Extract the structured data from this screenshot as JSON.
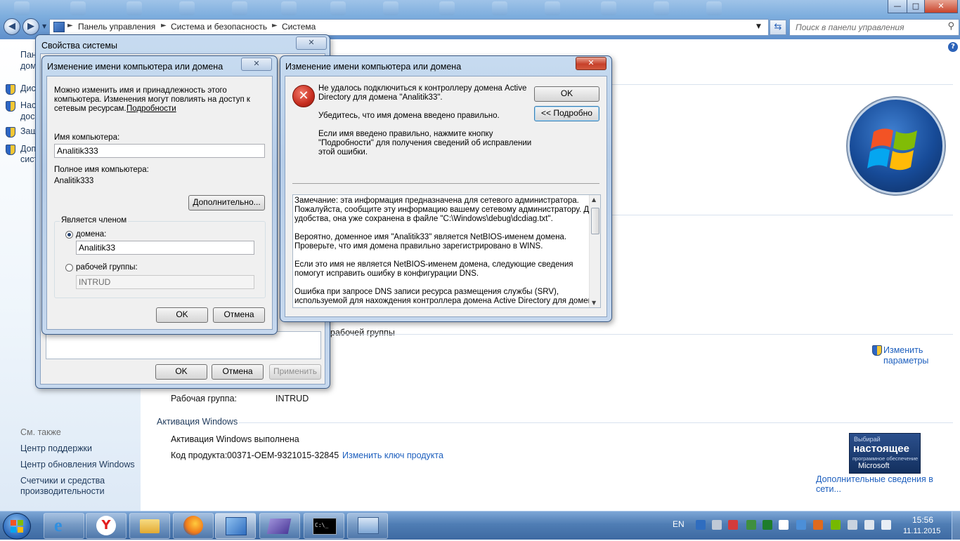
{
  "window": {
    "minimize": "—",
    "maximize": "□",
    "close": "✕"
  },
  "address": {
    "crumbs": [
      "Панель управления",
      "Система и безопасность",
      "Система"
    ],
    "separator": "►"
  },
  "search": {
    "placeholder": "Поиск в панели управления"
  },
  "left_pane": {
    "partial_items": [
      "Пан",
      "дом",
      "Дис",
      "Нас",
      "дос",
      "Защ",
      "Доп",
      "сист"
    ],
    "see_also_title": "См. также",
    "see_also": [
      "Центр поддержки",
      "Центр обновления Windows",
      "Счетчики и средства",
      "производительности"
    ]
  },
  "main": {
    "workgroup_fragment": "рабочей группы",
    "change_params": [
      "Изменить",
      "параметры"
    ],
    "workgroup_label": "Рабочая группа:",
    "workgroup_value": "INTRUD",
    "activation_header": "Активация Windows",
    "activation_status": "Активация Windows выполнена",
    "product_key_label": "Код продукта:",
    "product_key_value": "00371-OEM-9321015-32845",
    "change_key_link": "Изменить ключ продукта",
    "genuine_badge": {
      "line1": "Выбирай",
      "line2": "настоящее",
      "line3": "программное обеспечение",
      "line4": "Microsoft"
    },
    "more_info_link": "Дополнительные сведения в сети..."
  },
  "sysprops": {
    "title": "Свойства системы",
    "ok": "OK",
    "cancel": "Отмена",
    "apply": "Применить"
  },
  "rename": {
    "title": "Изменение имени компьютера или домена",
    "intro": [
      "Можно изменить имя и принадлежность этого",
      "компьютера. Изменения могут повлиять на доступ к",
      "сетевым ресурсам."
    ],
    "details_link": "Подробности",
    "computer_name_label": "Имя компьютера:",
    "computer_name_value": "Analitik333",
    "full_name_label": "Полное имя компьютера:",
    "full_name_value": "Analitik333",
    "more_button": "Дополнительно...",
    "member_of": "Является членом",
    "domain_label": "домена:",
    "domain_value": "Analitik33",
    "workgroup_label": "рабочей группы:",
    "workgroup_value": "INTRUD",
    "ok": "OK",
    "cancel": "Отмена"
  },
  "error": {
    "title": "Изменение имени компьютера или домена",
    "message": [
      "Не удалось подключиться к контроллеру домена Active",
      "Directory для домена \"Analitik33\"."
    ],
    "check": "Убедитесь, что имя домена введено правильно.",
    "hint": [
      "Если имя введено правильно, нажмите кнопку",
      "\"Подробности\" для получения сведений об исправлении",
      "этой ошибки."
    ],
    "ok": "OK",
    "details": "<< Подробно",
    "detail_text": [
      "Замечание: эта информация предназначена для сетевого администратора.",
      "Пожалуйста, сообщите эту информацию вашему сетевому администратору. Для",
      "удобства, она уже сохранена в файле \"C:\\Windows\\debug\\dcdiag.txt\".",
      "",
      "Вероятно, доменное имя \"Analitik33\" является NetBIOS-именем домена.",
      "Проверьте, что имя домена правильно зарегистрировано в WINS.",
      "",
      "Если это имя не является NetBIOS-именем домена, следующие сведения",
      "помогут исправить ошибку в конфигурации DNS.",
      "",
      "Ошибка при запросе DNS записи ресурса размещения службы (SRV),",
      "используемой для нахождения контроллера домена Active Directory для домена"
    ]
  },
  "taskbar": {
    "lang": "EN",
    "time": "15:56",
    "date": "11.11.2015",
    "apps": [
      "ie-icon",
      "yandex-icon",
      "explorer-icon",
      "firefox-icon",
      "control-panel-icon",
      "virtualbox-icon",
      "cmd-icon",
      "network-icon"
    ]
  },
  "colors": {
    "link": "#1d5fbe",
    "error_red": "#c62d1f",
    "taskbar": "#4f7db4",
    "title_gradient": "#b6cde8"
  }
}
